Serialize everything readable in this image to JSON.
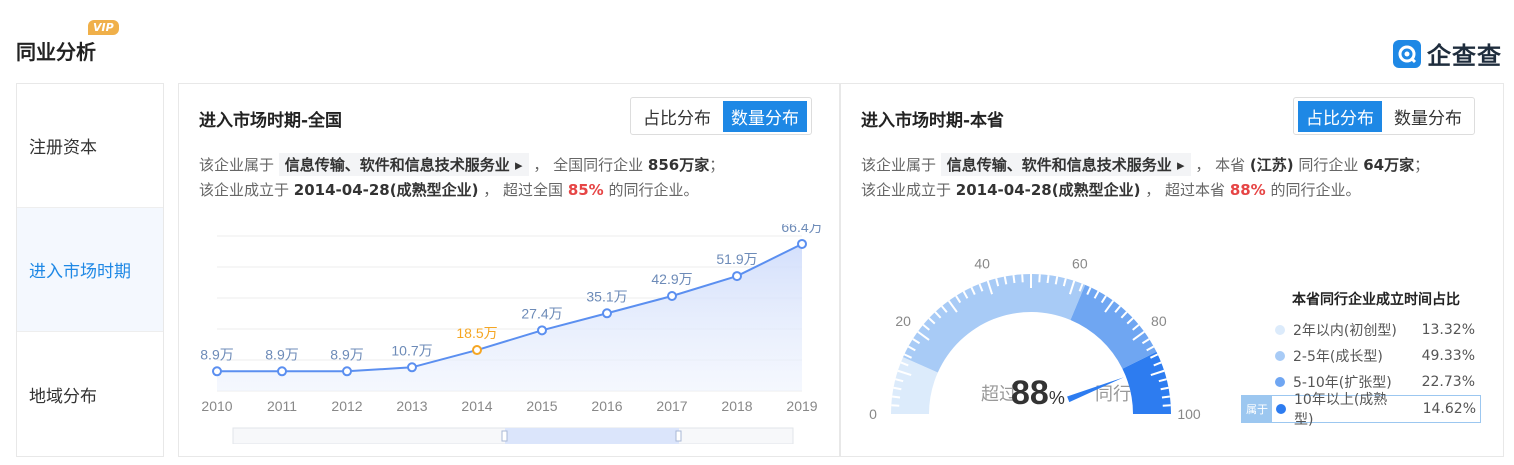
{
  "header": {
    "title": "同业分析",
    "vip_badge": "VIP",
    "brand_name": "企查查",
    "brand_icon": "qichacha-logo-icon"
  },
  "sidebar": {
    "items": [
      {
        "label": "注册资本",
        "active": false
      },
      {
        "label": "进入市场时期",
        "active": true
      },
      {
        "label": "地域分布",
        "active": false
      }
    ]
  },
  "panel_national": {
    "title": "进入市场时期-全国",
    "toggle": {
      "left": "占比分布",
      "right": "数量分布",
      "active": "数量分布"
    },
    "line1": {
      "prefix": "该企业属于",
      "industry": "信息传输、软件和信息技术服务业",
      "mid": "， 全国同行企业",
      "count": "856万家",
      "end": "；"
    },
    "line2": {
      "prefix": "该企业成立于",
      "date": "2014-04-28(成熟型企业)",
      "mid": "， 超过全国",
      "pct": "85%",
      "end": "的同行企业。"
    }
  },
  "panel_province": {
    "title": "进入市场时期-本省",
    "toggle": {
      "left": "占比分布",
      "right": "数量分布",
      "active": "占比分布"
    },
    "line1": {
      "prefix": "该企业属于",
      "industry": "信息传输、软件和信息技术服务业",
      "mid": "， 本省",
      "province": "(江苏)",
      "mid2": "同行企业",
      "count": "64万家",
      "end": "；"
    },
    "line2": {
      "prefix": "该企业成立于",
      "date": "2014-04-28(成熟型企业)",
      "mid": "， 超过本省",
      "pct": "88%",
      "end": "的同行企业。"
    },
    "gauge": {
      "prefix": "超过",
      "value_num": "88",
      "value_unit": "%",
      "suffix": "同行",
      "value": 88,
      "ticks": [
        "0",
        "20",
        "40",
        "60",
        "80",
        "100"
      ]
    },
    "legend": {
      "title": "本省同行企业成立时间占比",
      "belongs_label": "属于",
      "items": [
        {
          "label": "2年以内(初创型)",
          "value": "13.32%",
          "color": "#dcebfb"
        },
        {
          "label": "2-5年(成长型)",
          "value": "49.33%",
          "color": "#a8cbf6"
        },
        {
          "label": "5-10年(扩张型)",
          "value": "22.73%",
          "color": "#6fa6f2"
        },
        {
          "label": "10年以上(成熟型)",
          "value": "14.62%",
          "color": "#2d7cf0",
          "selected": true
        }
      ]
    }
  },
  "chart_data": {
    "type": "line",
    "categories": [
      "2010",
      "2011",
      "2012",
      "2013",
      "2014",
      "2015",
      "2016",
      "2017",
      "2018",
      "2019"
    ],
    "values": [
      8.9,
      8.9,
      8.9,
      10.7,
      18.5,
      27.4,
      35.1,
      42.9,
      51.9,
      66.4
    ],
    "labels": [
      "8.9万",
      "8.9万",
      "8.9万",
      "10.7万",
      "18.5万",
      "27.4万",
      "35.1万",
      "42.9万",
      "51.9万",
      "66.4万"
    ],
    "highlight": "2014",
    "line_color": "#5b8ff0",
    "highlight_color": "#f5a623",
    "ylim": [
      0,
      70
    ],
    "grid": true
  }
}
